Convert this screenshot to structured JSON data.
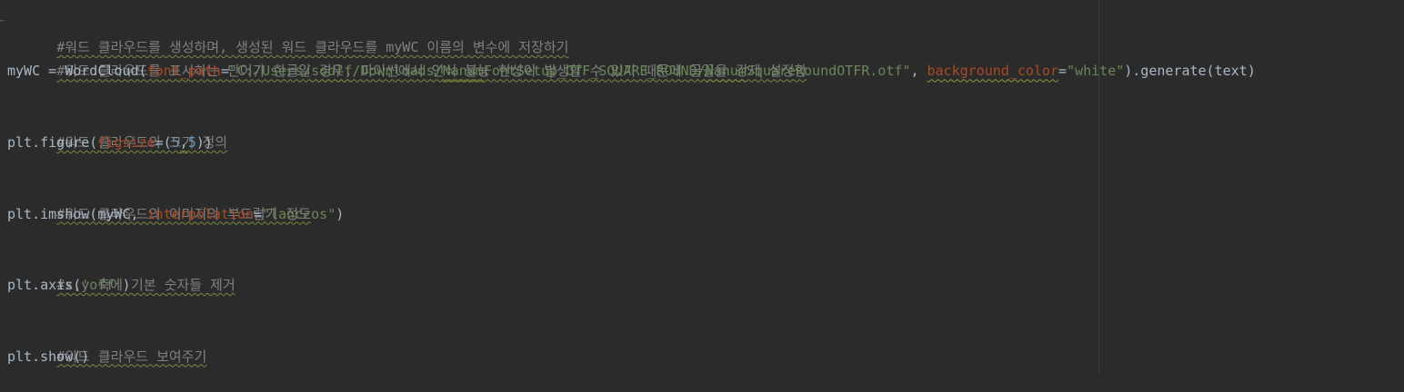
{
  "editor": {
    "lines": {
      "l1": {
        "comment": "#워드 클라우드를 생성하며, 생성된 워드 클라우드를 myWC 이름의 변수에 저장하기"
      },
      "l2": {
        "comment": "#워드 클라우드를 표시하는 단어가 한글일 경우, 파이썬에서 인식 불능 현상이 발생할 수 있기 때문에 글꼴을 강제 설정함"
      },
      "l3": {
        "lhs": "myWC = WordCloud(",
        "param1": "font_path",
        "eq1": "=",
        "str_a": "\"C:/Users/",
        "str_b": "sodlf",
        "str_c": "/Downloads/",
        "str_d": "Nanum",
        "str_e": "FontSetup_OTF_SQUARE_ROUND/",
        "str_f": "Nanum",
        "str_g": "SquareRoundOTFR.otf\"",
        "comma": ", ",
        "param2": "background_color",
        "eq2": "=",
        "str2": "\"white\"",
        "tail": ").generate(text)"
      },
      "l4": {
        "text": ""
      },
      "l5": {
        "comment": "#워드 클라우드의 크기 정의"
      },
      "l6": {
        "lhs": "plt.figure(",
        "param": "figsize",
        "eq": "=(",
        "num1": "5",
        "comma": ",",
        "num2": "5",
        "tail": "))"
      },
      "l7": {
        "text": ""
      },
      "l8": {
        "comment": "#워드 클라우드의 이미지의 부드럽기 정도"
      },
      "l9": {
        "lhs": "plt.imshow(myWC, ",
        "param": "interpolation",
        "eq": "=",
        "str": "\"lanczos\"",
        "tail": ")"
      },
      "l10": {
        "text": ""
      },
      "l11": {
        "comment": "#x,y 축에 기본 숫자들 제거"
      },
      "l12": {
        "lhs": "plt.axis(",
        "str": "'off'",
        "tail": ")"
      },
      "l13": {
        "text": ""
      },
      "l14": {
        "comment": "#워드 클라우드 보여주기"
      },
      "l15": {
        "text": "plt.show()"
      }
    }
  },
  "colors": {
    "background": "#2b2b2b",
    "comment": "#808080",
    "keyword_param": "#aa4926",
    "string": "#6a8759",
    "number": "#6897bb",
    "default_text": "#a9b7c6"
  },
  "icons": {
    "fold_marker": "fold-marker-icon"
  }
}
